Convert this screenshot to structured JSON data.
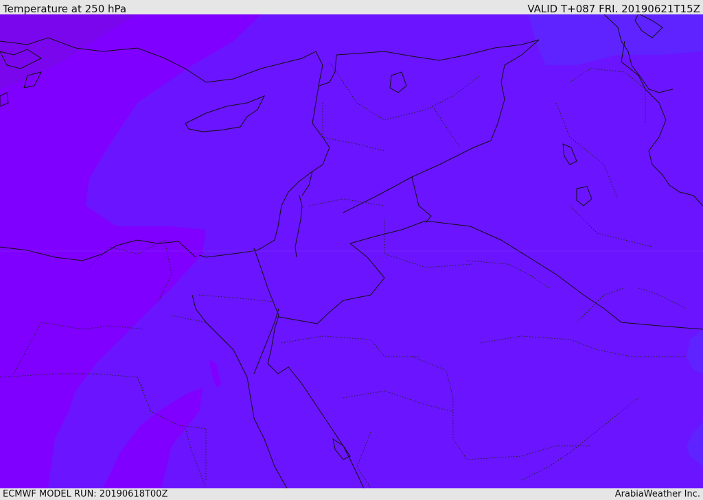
{
  "title": "Temperature at 250 hPa",
  "valid_time": "VALID T+087 FRI. 20190621T15Z",
  "model_run": "ECMWF MODEL RUN: 20190618T00Z",
  "credit": "ArabiaWeather Inc.",
  "colors": {
    "field_base": "#6b14ff",
    "field_warm": "#8000ff",
    "field_warmer": "#7a06ee",
    "field_cool": "#5e23ff",
    "field_coolest": "#5a2dff",
    "coast": "#111111",
    "borders": "#111111"
  }
}
